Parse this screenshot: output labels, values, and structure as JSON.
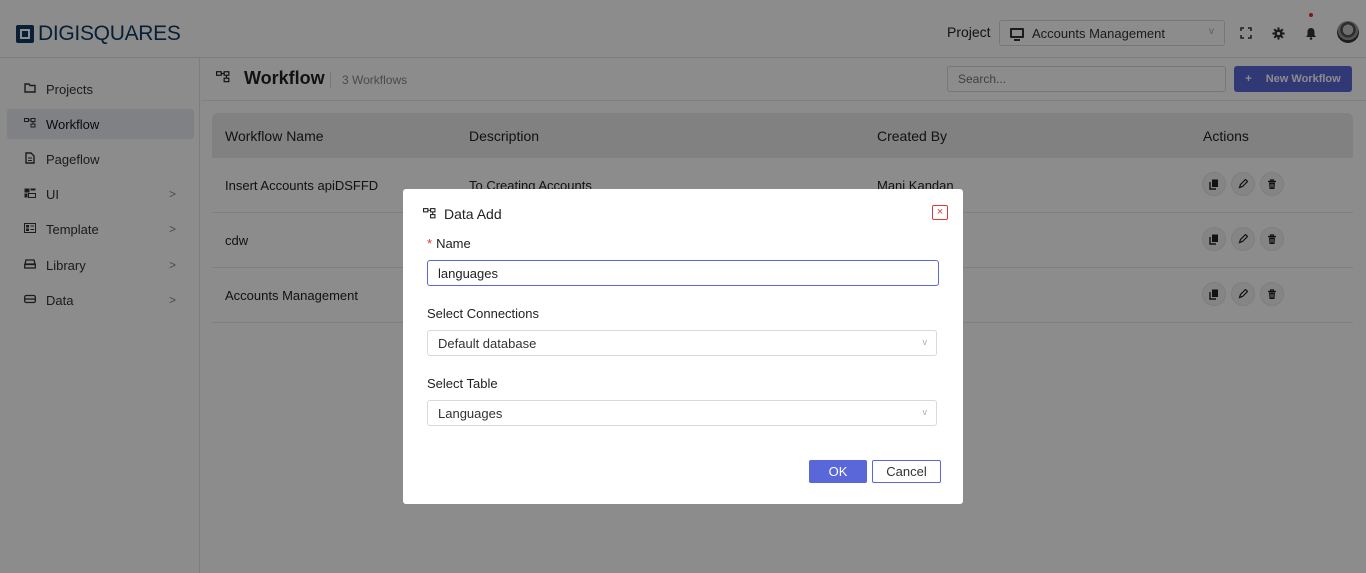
{
  "app": {
    "logo_text": "DIGISQUARES"
  },
  "header": {
    "project_label": "Project",
    "project_value": "Accounts Management",
    "icons": [
      "fullscreen-icon",
      "gear-icon",
      "bell-icon",
      "avatar"
    ]
  },
  "sidebar": {
    "items": [
      {
        "label": "Projects",
        "icon": "folder-icon"
      },
      {
        "label": "Workflow",
        "icon": "workflow-icon",
        "active": true
      },
      {
        "label": "Pageflow",
        "icon": "page-icon"
      },
      {
        "label": "UI",
        "icon": "ui-icon",
        "expandable": true
      },
      {
        "label": "Template",
        "icon": "template-icon",
        "expandable": true
      },
      {
        "label": "Library",
        "icon": "library-icon",
        "expandable": true
      },
      {
        "label": "Data",
        "icon": "data-icon",
        "expandable": true
      }
    ],
    "arrow": ">"
  },
  "content": {
    "title": "Workflow",
    "count": "3 Workflows",
    "search_placeholder": "Search...",
    "new_button": "New Workflow",
    "new_button_plus": "+"
  },
  "table": {
    "columns": [
      "Workflow Name",
      "Description",
      "Created By",
      "Actions"
    ],
    "rows": [
      {
        "name": "Insert Accounts apiDSFFD",
        "description": "To Creating Accounts",
        "created_by": "Mani Kandan"
      },
      {
        "name": "cdw",
        "description": "",
        "created_by": ""
      },
      {
        "name": "Accounts Management",
        "description": "",
        "created_by": ""
      }
    ]
  },
  "modal": {
    "title": "Data Add",
    "close": "×",
    "name_label": "Name",
    "required_mark": "*",
    "name_value": "languages",
    "connections_label": "Select Connections",
    "connections_value": "Default database",
    "table_label": "Select Table",
    "table_value": "Languages",
    "chevron": "v",
    "ok_label": "OK",
    "cancel_label": "Cancel"
  },
  "colors": {
    "accent": "#5a67d8",
    "brand": "#0f3a63",
    "danger": "#e53935"
  }
}
